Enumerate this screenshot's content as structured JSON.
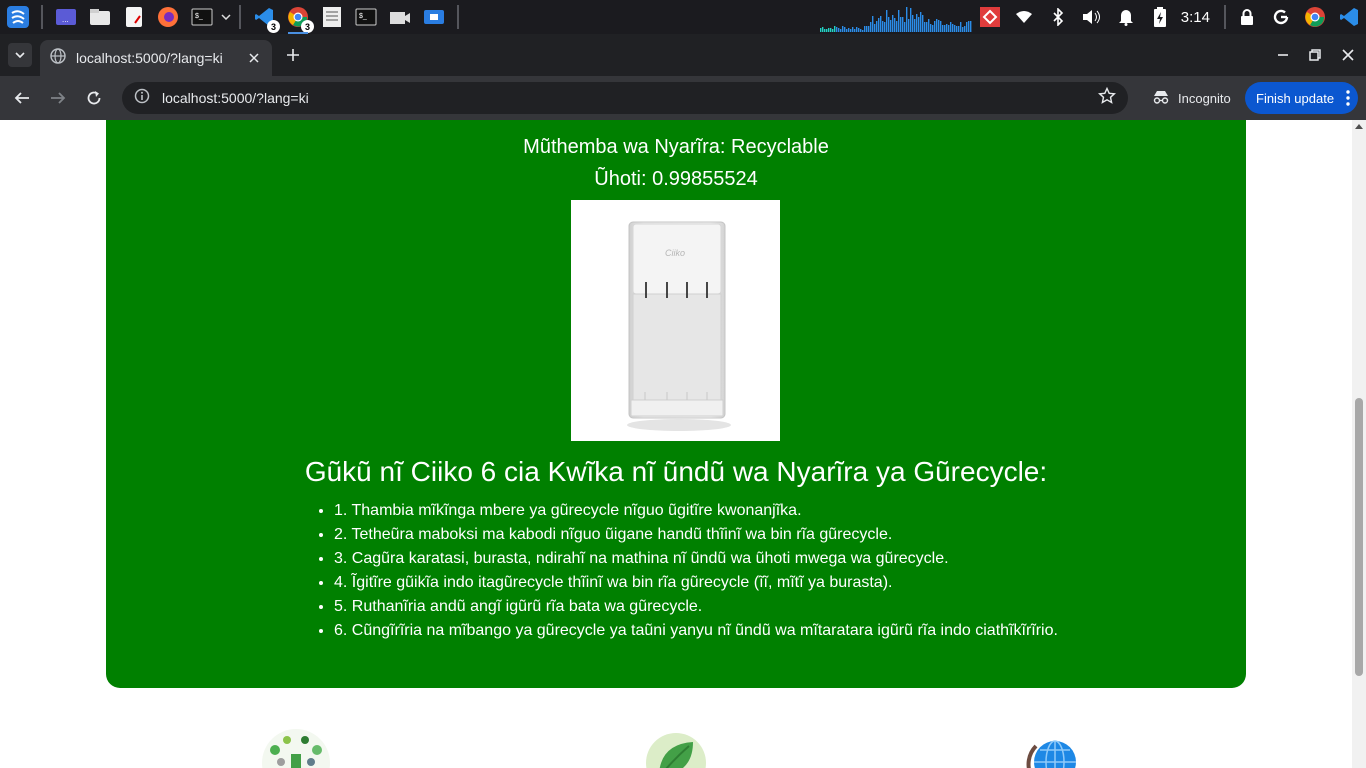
{
  "taskbar": {
    "time": "3:14",
    "badges": {
      "vscode": "3",
      "chrome": "3"
    }
  },
  "browser": {
    "tab_title": "localhost:5000/?lang=ki",
    "url": "localhost:5000/?lang=ki",
    "incognito_label": "Incognito",
    "finish_update_label": "Finish update"
  },
  "result": {
    "category_line": "Mũthemba wa Nyarĩra: Recyclable",
    "confidence_line": "Ũhoti: 0.99855524",
    "steps_heading": "Gũkũ nĩ Ciiko 6 cia Kwĩka nĩ ũndũ wa Nyarĩra ya Gũrecycle:",
    "steps": [
      "1. Thambia mĩkĩnga mbere ya gũrecycle nĩguo ũgitĩre kwonanjĩka.",
      "2. Tetheũra maboksi ma kabodi nĩguo ũigane handũ thĩinĩ wa bin rĩa gũrecycle.",
      "3. Cagũra karatasi, burasta, ndirahĩ na mathina nĩ ũndũ wa ũhoti mwega wa gũrecycle.",
      "4. Ĩgitĩre gũikĩa indo itagũrecycle thĩinĩ wa bin rĩa gũrecycle (ĩĩ, mĩtĩ ya burasta).",
      "5. Ruthanĩria andũ angĩ igũrũ rĩa bata wa gũrecycle.",
      "6. Cũngĩrĩria na mĩbango ya gũrecycle ya taũni yanyu nĩ ũndũ wa mĩtaratara igũrũ rĩa indo ciathĩkĩrĩrio."
    ]
  },
  "colors": {
    "card_green": "#008000",
    "chrome_dark": "#202124",
    "chrome_toolbar": "#35363a",
    "update_blue": "#0b57d0"
  },
  "icons": {
    "footer": [
      "recycling-collage-icon",
      "leaf-icon",
      "globe-icon"
    ]
  }
}
